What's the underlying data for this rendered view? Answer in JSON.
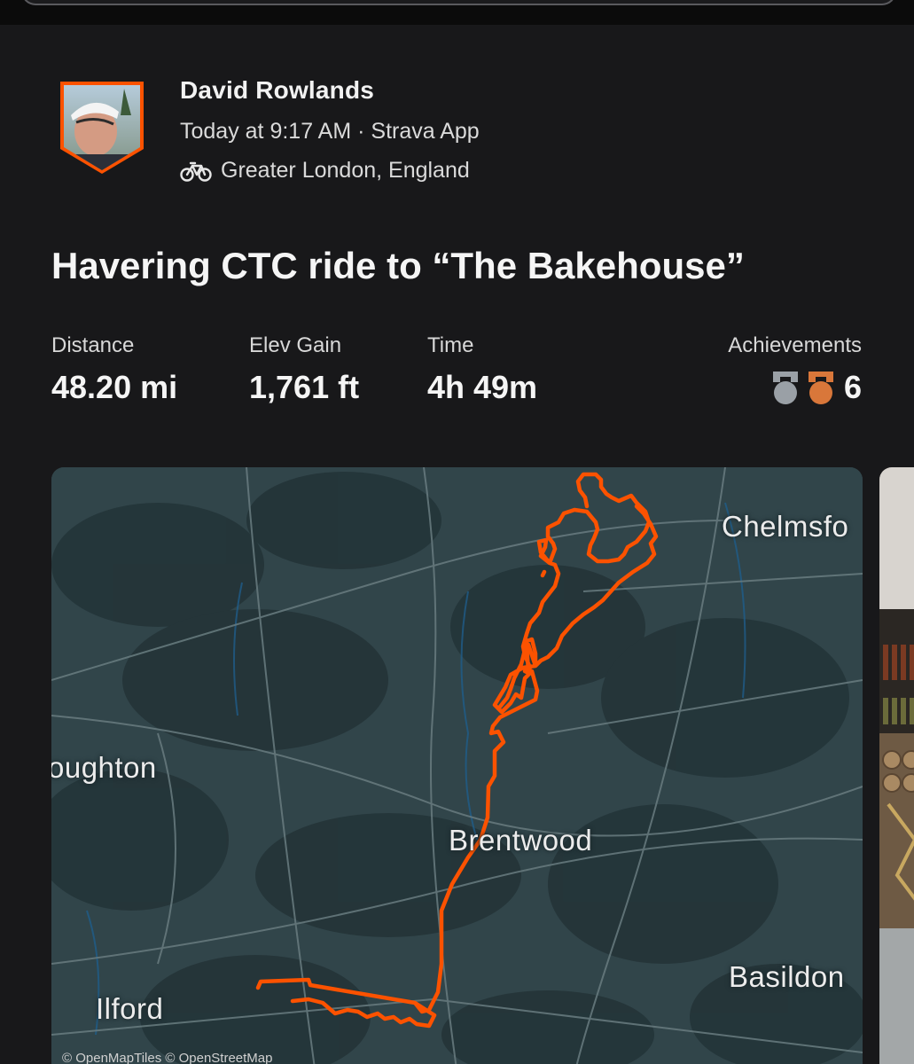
{
  "athlete": {
    "name": "David  Rowlands",
    "meta": "Today at 9:17 AM · Strava App",
    "location": "Greater London, England",
    "avatar_icon": "profile-photo"
  },
  "activity": {
    "title": "Havering CTC ride to “The Bakehouse”",
    "type_icon": "bike-icon"
  },
  "stats": [
    {
      "label": "Distance",
      "value": "48.20 mi"
    },
    {
      "label": "Elev Gain",
      "value": "1,761 ft"
    },
    {
      "label": "Time",
      "value": "4h 49m"
    }
  ],
  "achievements": {
    "label": "Achievements",
    "count": "6",
    "medal_colors": [
      "#9aa0a6",
      "#d9773a"
    ]
  },
  "map": {
    "places": [
      "Chelmsfo",
      "oughton",
      "Brentwood",
      "Basildon",
      "Ilford"
    ],
    "attribution": "© OpenMapTiles © OpenStreetMap",
    "route_color": "#fc5200"
  }
}
